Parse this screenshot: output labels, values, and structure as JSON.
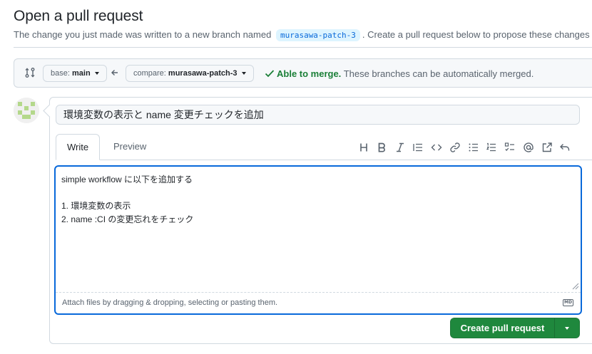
{
  "header": {
    "title": "Open a pull request",
    "subtitle_before": "The change you just made was written to a new branch named",
    "branch_name": "murasawa-patch-3",
    "subtitle_after": ". Create a pull request below to propose these changes"
  },
  "range": {
    "base_prefix": "base:",
    "base_value": "main",
    "compare_prefix": "compare:",
    "compare_value": "murasawa-patch-3",
    "merge_ok": "Able to merge.",
    "merge_msg": "These branches can be automatically merged."
  },
  "form": {
    "title_value": "環境変数の表示と name 変更チェックを追加",
    "tabs": {
      "write": "Write",
      "preview": "Preview"
    },
    "toolbar_icons": [
      "heading-icon",
      "bold-icon",
      "italic-icon",
      "quote-icon",
      "code-icon",
      "link-icon",
      "unordered-list-icon",
      "ordered-list-icon",
      "task-list-icon",
      "mention-icon",
      "cross-reference-icon",
      "undo-icon"
    ],
    "body": "simple workflow に以下を追加する\n\n1. 環境変数の表示\n2. name :CI の変更忘れをチェック",
    "attach_text": "Attach files by dragging & dropping, selecting or pasting them.",
    "markdown_badge": "MD",
    "submit_label": "Create pull request"
  },
  "colors": {
    "accent": "#0969da",
    "success": "#1a7f37",
    "button": "#1f883d"
  }
}
